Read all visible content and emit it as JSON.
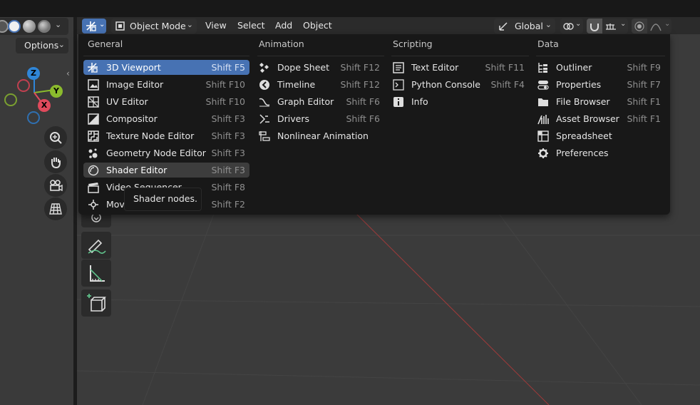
{
  "header": {
    "mode_label": "Object Mode",
    "menus": [
      "View",
      "Select",
      "Add",
      "Object"
    ],
    "orientation_label": "Global",
    "options_label": "Options"
  },
  "gizmo": {
    "z": "Z",
    "y": "Y",
    "x": "X"
  },
  "colors": {
    "accent": "#4772b3",
    "axis_x": "#e04a5c",
    "axis_y": "#8bbb2d",
    "axis_z": "#2f86d8",
    "menu_bg": "#181818",
    "viewport_bg": "#3b3b3b"
  },
  "editor_menu": {
    "columns": [
      {
        "heading": "General",
        "items": [
          {
            "label": "3D Viewport",
            "shortcut": "Shift F5",
            "icon": "viewport-3d-icon",
            "state": "selected"
          },
          {
            "label": "Image Editor",
            "shortcut": "Shift F10",
            "icon": "image-editor-icon"
          },
          {
            "label": "UV Editor",
            "shortcut": "Shift F10",
            "icon": "uv-editor-icon"
          },
          {
            "label": "Compositor",
            "shortcut": "Shift F3",
            "icon": "compositor-icon"
          },
          {
            "label": "Texture Node Editor",
            "shortcut": "Shift F3",
            "icon": "texture-node-icon"
          },
          {
            "label": "Geometry Node Editor",
            "shortcut": "Shift F3",
            "icon": "geometry-node-icon"
          },
          {
            "label": "Shader Editor",
            "shortcut": "Shift F3",
            "icon": "shader-editor-icon",
            "state": "hover"
          },
          {
            "label": "Video Sequencer",
            "shortcut": "Shift F8",
            "icon": "video-sequencer-icon"
          },
          {
            "label": "Movie Clip Editor",
            "shortcut": "Shift F2",
            "icon": "movie-clip-icon"
          }
        ]
      },
      {
        "heading": "Animation",
        "items": [
          {
            "label": "Dope Sheet",
            "shortcut": "Shift F12",
            "icon": "dope-sheet-icon"
          },
          {
            "label": "Timeline",
            "shortcut": "Shift F12",
            "icon": "timeline-icon"
          },
          {
            "label": "Graph Editor",
            "shortcut": "Shift F6",
            "icon": "graph-editor-icon"
          },
          {
            "label": "Drivers",
            "shortcut": "Shift F6",
            "icon": "drivers-icon"
          },
          {
            "label": "Nonlinear Animation",
            "shortcut": "",
            "icon": "nla-icon"
          }
        ]
      },
      {
        "heading": "Scripting",
        "items": [
          {
            "label": "Text Editor",
            "shortcut": "Shift F11",
            "icon": "text-editor-icon"
          },
          {
            "label": "Python Console",
            "shortcut": "Shift F4",
            "icon": "python-console-icon"
          },
          {
            "label": "Info",
            "shortcut": "",
            "icon": "info-icon"
          }
        ]
      },
      {
        "heading": "Data",
        "items": [
          {
            "label": "Outliner",
            "shortcut": "Shift F9",
            "icon": "outliner-icon"
          },
          {
            "label": "Properties",
            "shortcut": "Shift F7",
            "icon": "properties-icon"
          },
          {
            "label": "File Browser",
            "shortcut": "Shift F1",
            "icon": "file-browser-icon"
          },
          {
            "label": "Asset Browser",
            "shortcut": "Shift F1",
            "icon": "asset-browser-icon"
          },
          {
            "label": "Spreadsheet",
            "shortcut": "",
            "icon": "spreadsheet-icon"
          },
          {
            "label": "Preferences",
            "shortcut": "",
            "icon": "preferences-icon"
          }
        ]
      }
    ]
  },
  "tooltip": {
    "text": "Shader nodes."
  }
}
